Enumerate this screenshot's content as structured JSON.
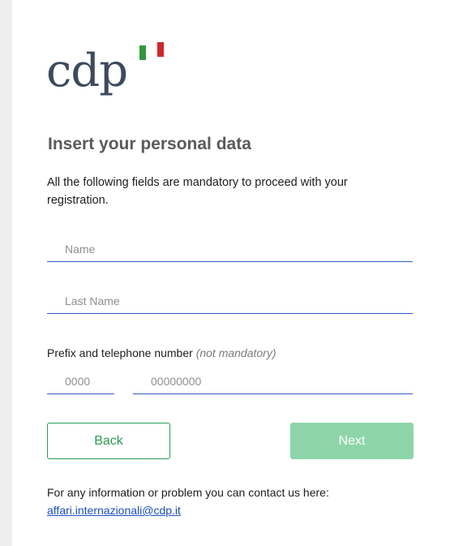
{
  "logo": {
    "text": "cdp",
    "flag_colors": [
      "#2e9a3f",
      "#ffffff",
      "#d3262b"
    ]
  },
  "form": {
    "title": "Insert your personal data",
    "subtitle": "All the following fields are mandatory to proceed with your registration.",
    "name_placeholder": "Name",
    "lastname_placeholder": "Last Name",
    "phone_label": "Prefix and telephone number",
    "phone_label_optional": "(not mandatory)",
    "prefix_placeholder": "0000",
    "phone_placeholder": "00000000"
  },
  "buttons": {
    "back_label": "Back",
    "next_label": "Next"
  },
  "contact": {
    "text": "For any information or problem you can contact us here:",
    "email": "affari.internazionali@cdp.it"
  },
  "colors": {
    "accent_green": "#2a9a55",
    "next_disabled": "#8dd5a9",
    "field_underline": "#2f5fc0",
    "link": "#1a4fc4"
  }
}
